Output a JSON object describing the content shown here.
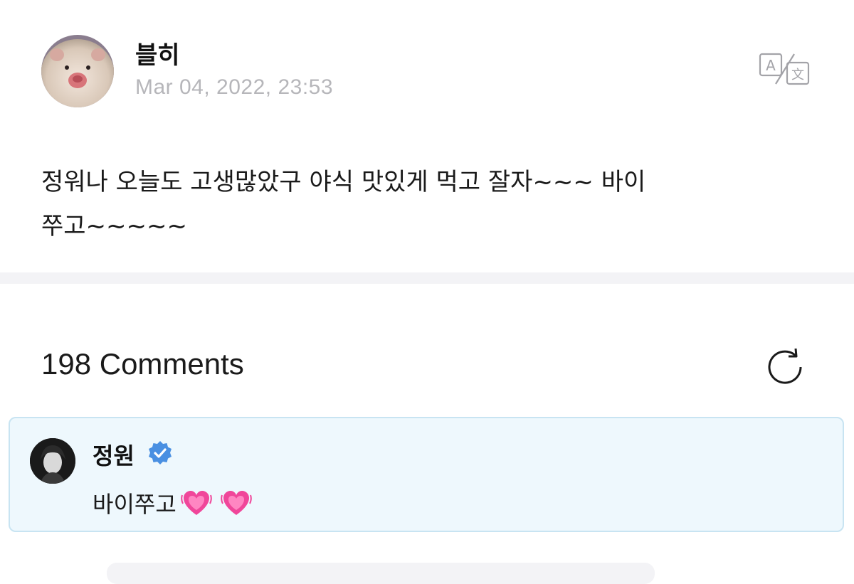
{
  "post": {
    "author": "블히",
    "date": "Mar 04, 2022, 23:53",
    "body": "정워나 오늘도 고생많았구 야식 맛있게 먹고 잘자~~~ 바이\n쭈고~~~~~",
    "avatar_icon": "hamster-avatar",
    "translate_icon": "translate-icon"
  },
  "comments": {
    "title": "198 Comments",
    "refresh_icon": "refresh-icon",
    "items": [
      {
        "author": "정원",
        "verified": true,
        "text": "바이쭈고",
        "emojis": [
          "heart-icon",
          "heart-icon"
        ],
        "highlight_color": "#eef8fd"
      }
    ]
  },
  "colors": {
    "verified": "#4a90e2",
    "heart": "#f0469a",
    "date": "#b6b6ba"
  }
}
